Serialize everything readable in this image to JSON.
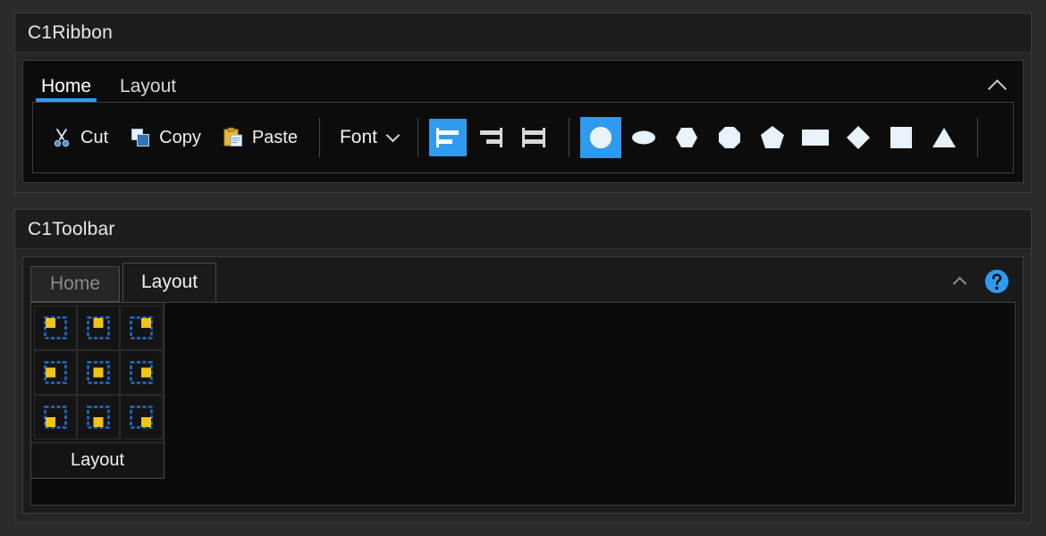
{
  "ribbon_section": {
    "title": "C1Ribbon",
    "tabs": [
      {
        "label": "Home",
        "active": true
      },
      {
        "label": "Layout",
        "active": false
      }
    ],
    "collapse_icon": "chevron-up-icon",
    "clipboard": [
      {
        "label": "Cut",
        "icon": "scissors-icon"
      },
      {
        "label": "Copy",
        "icon": "copy-icon"
      },
      {
        "label": "Paste",
        "icon": "paste-icon"
      }
    ],
    "font_dropdown": {
      "label": "Font",
      "icon": "chevron-down-icon"
    },
    "alignment": [
      {
        "name": "align-left",
        "selected": true
      },
      {
        "name": "align-right",
        "selected": false
      },
      {
        "name": "align-center",
        "selected": false
      }
    ],
    "shapes": [
      {
        "name": "circle",
        "selected": true
      },
      {
        "name": "ellipse",
        "selected": false
      },
      {
        "name": "hexagon",
        "selected": false
      },
      {
        "name": "octagon",
        "selected": false
      },
      {
        "name": "pentagon",
        "selected": false
      },
      {
        "name": "rectangle",
        "selected": false
      },
      {
        "name": "diamond",
        "selected": false
      },
      {
        "name": "square",
        "selected": false
      },
      {
        "name": "triangle",
        "selected": false
      }
    ]
  },
  "toolbar_section": {
    "title": "C1Toolbar",
    "tabs": [
      {
        "label": "Home",
        "active": false
      },
      {
        "label": "Layout",
        "active": true
      }
    ],
    "collapse_icon": "chevron-up-icon",
    "help_icon": "help-circle-icon",
    "layout_gallery": {
      "label": "Layout",
      "cells": [
        {
          "name": "anchor-top-left"
        },
        {
          "name": "anchor-top-center"
        },
        {
          "name": "anchor-top-right"
        },
        {
          "name": "anchor-middle-left"
        },
        {
          "name": "anchor-middle-center"
        },
        {
          "name": "anchor-middle-right"
        },
        {
          "name": "anchor-bottom-left"
        },
        {
          "name": "anchor-bottom-center"
        },
        {
          "name": "anchor-bottom-right"
        }
      ]
    }
  },
  "colors": {
    "accent": "#2e9bf0",
    "anchor_fill": "#f0c419",
    "anchor_frame": "#1f6fd0",
    "panel_bg": "#1d1d1d",
    "app_bg": "#2b2b2b"
  }
}
